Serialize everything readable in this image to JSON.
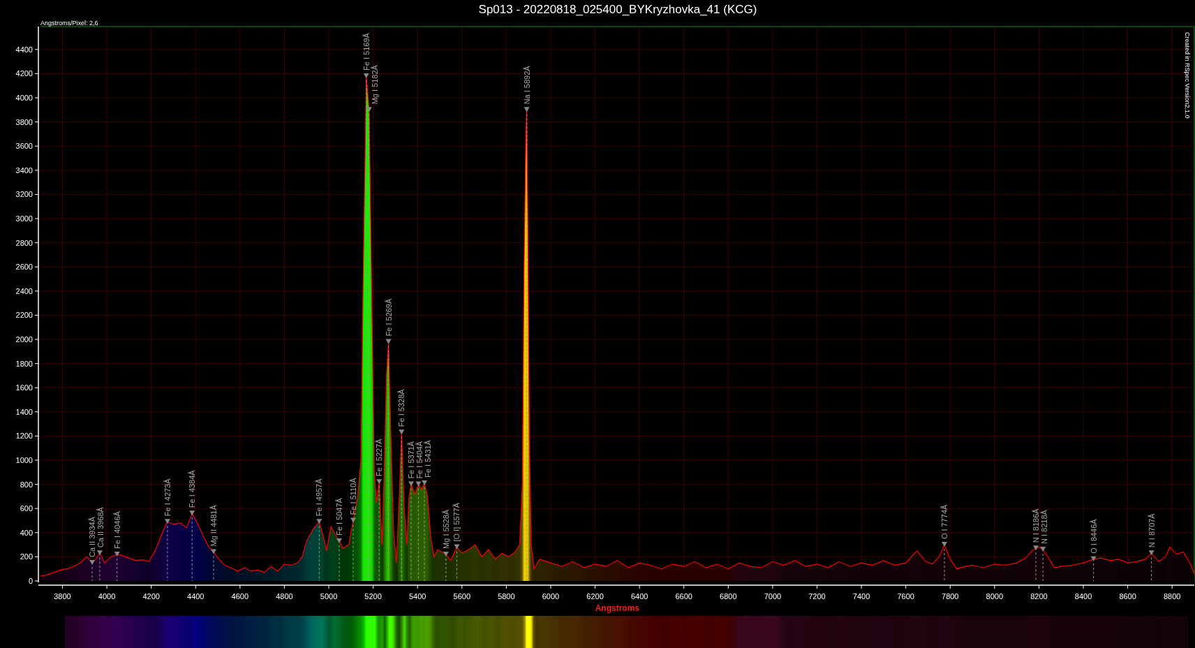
{
  "title": "Sp013 - 20220818_025400_BYKryzhovka_41 (KCG)",
  "scale_note": "Angstroms/Pixel: 2,6",
  "credit": "Created in RSpec Version2.1.0",
  "chart_data": {
    "type": "area",
    "xlabel": "Angstroms",
    "grid": true,
    "x": [
      3700,
      3730,
      3760,
      3790,
      3820,
      3850,
      3880,
      3910,
      3934,
      3950,
      3968,
      3990,
      4020,
      4046,
      4070,
      4100,
      4130,
      4160,
      4190,
      4220,
      4250,
      4273,
      4300,
      4330,
      4360,
      4384,
      4410,
      4440,
      4460,
      4481,
      4500,
      4530,
      4560,
      4590,
      4620,
      4650,
      4680,
      4710,
      4740,
      4770,
      4800,
      4830,
      4860,
      4880,
      4900,
      4930,
      4957,
      4975,
      4990,
      5010,
      5030,
      5047,
      5065,
      5090,
      5110,
      5130,
      5145,
      5155,
      5169,
      5182,
      5195,
      5205,
      5215,
      5227,
      5240,
      5250,
      5260,
      5269,
      5280,
      5292,
      5305,
      5318,
      5328,
      5340,
      5352,
      5362,
      5371,
      5388,
      5404,
      5418,
      5431,
      5445,
      5460,
      5475,
      5490,
      5510,
      5528,
      5550,
      5577,
      5600,
      5630,
      5660,
      5690,
      5720,
      5750,
      5780,
      5810,
      5840,
      5860,
      5872,
      5880,
      5888,
      5892,
      5897,
      5904,
      5912,
      5925,
      5950,
      6000,
      6050,
      6100,
      6150,
      6200,
      6250,
      6300,
      6350,
      6400,
      6450,
      6500,
      6550,
      6600,
      6650,
      6700,
      6750,
      6800,
      6850,
      6900,
      6950,
      7000,
      7050,
      7100,
      7150,
      7200,
      7250,
      7300,
      7350,
      7400,
      7450,
      7500,
      7550,
      7600,
      7650,
      7690,
      7720,
      7750,
      7774,
      7800,
      7830,
      7870,
      7900,
      7950,
      8000,
      8050,
      8100,
      8140,
      8170,
      8186,
      8200,
      8218,
      8240,
      8270,
      8300,
      8350,
      8400,
      8446,
      8480,
      8520,
      8560,
      8600,
      8640,
      8680,
      8707,
      8740,
      8770,
      8790,
      8820,
      8850,
      8880,
      8900
    ],
    "series": [
      {
        "color": "#ff0000",
        "values": [
          40,
          50,
          70,
          90,
          100,
          120,
          150,
          200,
          150,
          180,
          230,
          150,
          200,
          220,
          210,
          190,
          170,
          175,
          160,
          260,
          400,
          490,
          470,
          480,
          440,
          560,
          470,
          350,
          280,
          240,
          190,
          130,
          110,
          80,
          110,
          80,
          90,
          70,
          120,
          80,
          140,
          130,
          150,
          200,
          330,
          430,
          490,
          370,
          250,
          450,
          380,
          330,
          270,
          300,
          500,
          700,
          1000,
          2500,
          4180,
          3900,
          2200,
          900,
          650,
          820,
          300,
          900,
          1700,
          1980,
          1200,
          400,
          150,
          700,
          1230,
          600,
          300,
          700,
          800,
          720,
          800,
          760,
          810,
          700,
          350,
          200,
          260,
          240,
          220,
          170,
          280,
          230,
          260,
          300,
          200,
          260,
          180,
          230,
          200,
          240,
          300,
          800,
          2600,
          3700,
          3900,
          3000,
          1200,
          300,
          100,
          180,
          150,
          120,
          160,
          110,
          140,
          120,
          170,
          110,
          150,
          130,
          100,
          140,
          120,
          160,
          110,
          140,
          100,
          150,
          120,
          110,
          160,
          130,
          170,
          120,
          140,
          110,
          160,
          120,
          150,
          130,
          170,
          130,
          150,
          250,
          160,
          140,
          200,
          300,
          180,
          100,
          120,
          130,
          110,
          140,
          130,
          150,
          190,
          250,
          270,
          280,
          260,
          200,
          110,
          120,
          130,
          150,
          180,
          190,
          170,
          180,
          150,
          160,
          180,
          230,
          160,
          200,
          280,
          220,
          240,
          150,
          60
        ]
      }
    ],
    "xlim": [
      3700,
      8900
    ],
    "ylim": [
      0,
      4590
    ],
    "xticks": [
      3800,
      4000,
      4200,
      4400,
      4600,
      4800,
      5000,
      5200,
      5400,
      5600,
      5800,
      6000,
      6200,
      6400,
      6600,
      6800,
      7000,
      7200,
      7400,
      7600,
      7800,
      8000,
      8200,
      8400,
      8600,
      8800
    ],
    "yticks": [
      0,
      200,
      400,
      600,
      800,
      1000,
      1200,
      1400,
      1600,
      1800,
      2000,
      2200,
      2400,
      2600,
      2800,
      3000,
      3200,
      3400,
      3600,
      3800,
      4000,
      4200,
      4400
    ],
    "annotations": [
      {
        "x": 3934,
        "y": 150,
        "text": "Ca II 3934Å"
      },
      {
        "x": 3968,
        "y": 230,
        "text": "Ca II 3968Å"
      },
      {
        "x": 4046,
        "y": 220,
        "text": "Fe I 4046Å"
      },
      {
        "x": 4273,
        "y": 490,
        "text": "Fe I 4273Å"
      },
      {
        "x": 4384,
        "y": 560,
        "text": "Fe I 4384Å"
      },
      {
        "x": 4481,
        "y": 240,
        "text": "Mg II 4481Å"
      },
      {
        "x": 4957,
        "y": 490,
        "text": "Fe I 4957Å"
      },
      {
        "x": 5047,
        "y": 330,
        "text": "Fe I 5047Å"
      },
      {
        "x": 5110,
        "y": 500,
        "text": "Fe I 5110Å"
      },
      {
        "x": 5169,
        "y": 4180,
        "text": "Fe I 5169Å"
      },
      {
        "x": 5182,
        "y": 3900,
        "text": "Mg I 5182Å"
      },
      {
        "x": 5227,
        "y": 820,
        "text": "Fe I 5227Å"
      },
      {
        "x": 5269,
        "y": 1980,
        "text": "Fe I 5269Å"
      },
      {
        "x": 5328,
        "y": 1230,
        "text": "Fe I 5328Å"
      },
      {
        "x": 5371,
        "y": 800,
        "text": "Fe I 5371Å"
      },
      {
        "x": 5404,
        "y": 800,
        "text": "Fe I 5404Å"
      },
      {
        "x": 5431,
        "y": 810,
        "text": "Fe I 5431Å"
      },
      {
        "x": 5528,
        "y": 220,
        "text": "Mg I 5528Å"
      },
      {
        "x": 5577,
        "y": 280,
        "text": "[O I] 5577Å"
      },
      {
        "x": 5892,
        "y": 3900,
        "text": "Na I 5892Å"
      },
      {
        "x": 7774,
        "y": 300,
        "text": "O I 7774Å"
      },
      {
        "x": 8186,
        "y": 270,
        "text": "N I 8186Å"
      },
      {
        "x": 8218,
        "y": 260,
        "text": "N I 8218Å"
      },
      {
        "x": 8446,
        "y": 180,
        "text": "O I 8446Å"
      },
      {
        "x": 8707,
        "y": 230,
        "text": "N I 8707Å"
      }
    ]
  }
}
